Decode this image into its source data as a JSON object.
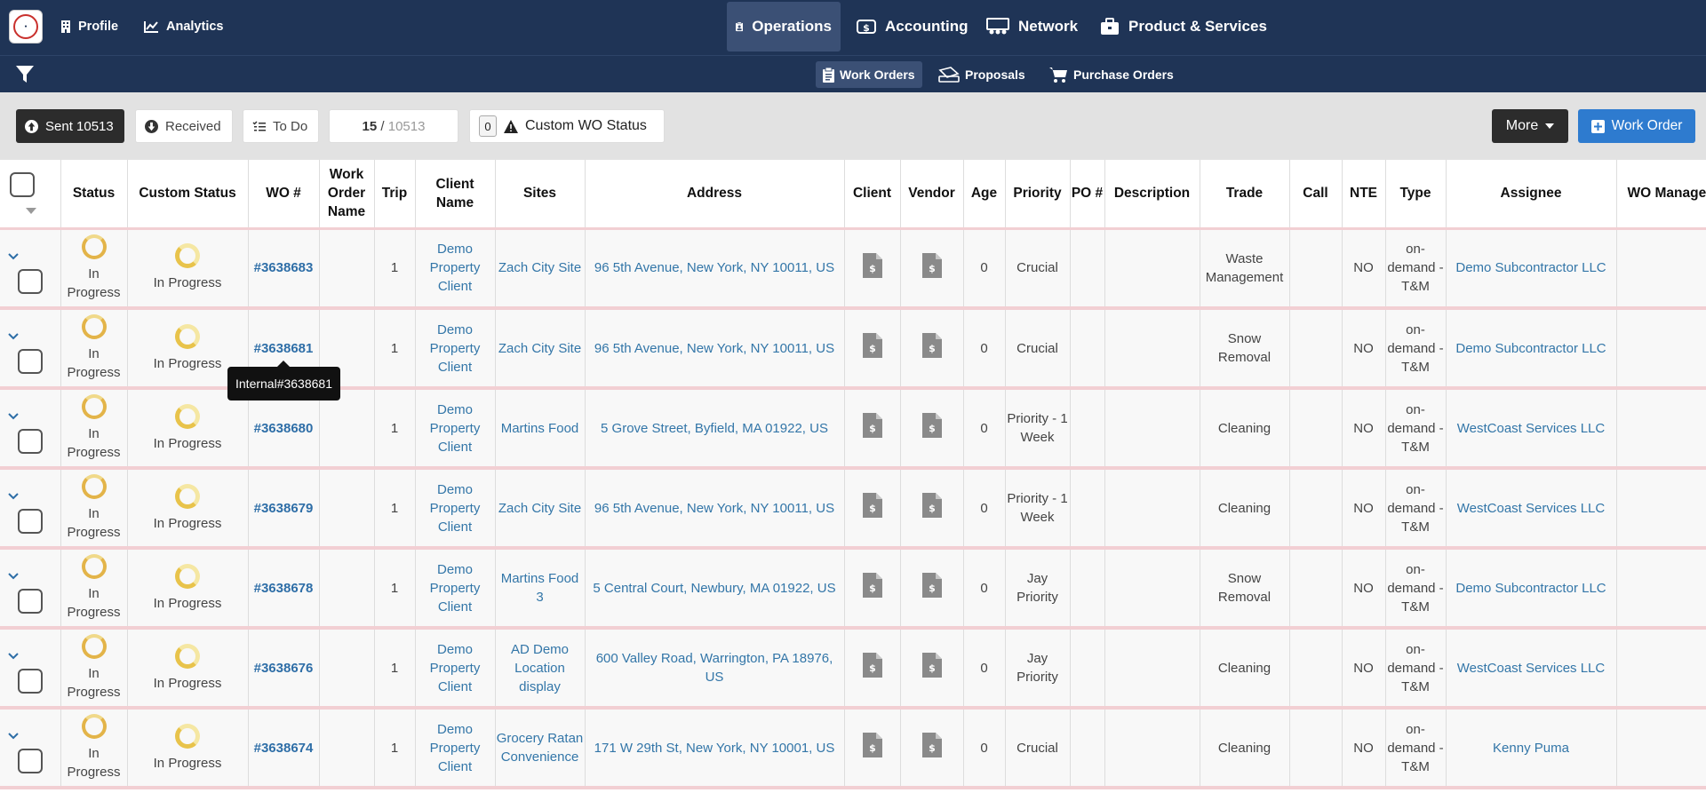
{
  "nav": {
    "profile": "Profile",
    "analytics": "Analytics",
    "operations": "Operations",
    "accounting": "Accounting",
    "network": "Network",
    "products": "Product & Services"
  },
  "subnav": {
    "work_orders": "Work Orders",
    "proposals": "Proposals",
    "purchase_orders": "Purchase Orders"
  },
  "toolbar": {
    "sent": "Sent 10513",
    "received": "Received",
    "todo": "To Do",
    "shown": "15",
    "separator": " / ",
    "total": "10513",
    "custom_count": "0",
    "custom_label": "Custom WO Status",
    "more": "More",
    "work_order": "Work Order"
  },
  "columns": [
    "Status",
    "Custom Status",
    "WO #",
    "Work Order Name",
    "Trip",
    "Client Name",
    "Sites",
    "Address",
    "Client",
    "Vendor",
    "Age",
    "Priority",
    "PO #",
    "Description",
    "Trade",
    "Call",
    "NTE",
    "Type",
    "Assignee",
    "WO Manager"
  ],
  "rows": [
    {
      "status": "In Progress",
      "custom": "In Progress",
      "wo": "#3638683",
      "name": "",
      "trip": "1",
      "client": "Demo Property Client",
      "site": "Zach City Site",
      "address": "96 5th Avenue, New York, NY 10011, US",
      "age": "0",
      "priority": "Crucial",
      "po": "",
      "desc": "",
      "trade": "Waste Management",
      "call": "",
      "nte": "NO",
      "type": "on-demand - T&M",
      "assignee": "Demo Subcontractor LLC",
      "manager": ""
    },
    {
      "status": "In Progress",
      "custom": "In Progress",
      "wo": "#3638681",
      "name": "",
      "trip": "1",
      "client": "Demo Property Client",
      "site": "Zach City Site",
      "address": "96 5th Avenue, New York, NY 10011, US",
      "age": "0",
      "priority": "Crucial",
      "po": "",
      "desc": "",
      "trade": "Snow Removal",
      "call": "",
      "nte": "NO",
      "type": "on-demand - T&M",
      "assignee": "Demo Subcontractor LLC",
      "manager": ""
    },
    {
      "status": "In Progress",
      "custom": "In Progress",
      "wo": "#3638680",
      "name": "",
      "trip": "1",
      "client": "Demo Property Client",
      "site": "Martins Food",
      "address": "5 Grove Street, Byfield, MA 01922, US",
      "age": "0",
      "priority": "Priority - 1 Week",
      "po": "",
      "desc": "",
      "trade": "Cleaning",
      "call": "",
      "nte": "NO",
      "type": "on-demand - T&M",
      "assignee": "WestCoast Services LLC",
      "manager": ""
    },
    {
      "status": "In Progress",
      "custom": "In Progress",
      "wo": "#3638679",
      "name": "",
      "trip": "1",
      "client": "Demo Property Client",
      "site": "Zach City Site",
      "address": "96 5th Avenue, New York, NY 10011, US",
      "age": "0",
      "priority": "Priority - 1 Week",
      "po": "",
      "desc": "",
      "trade": "Cleaning",
      "call": "",
      "nte": "NO",
      "type": "on-demand - T&M",
      "assignee": "WestCoast Services LLC",
      "manager": ""
    },
    {
      "status": "In Progress",
      "custom": "In Progress",
      "wo": "#3638678",
      "name": "",
      "trip": "1",
      "client": "Demo Property Client",
      "site": "Martins Food 3",
      "address": "5 Central Court, Newbury, MA 01922, US",
      "age": "0",
      "priority": "Jay Priority",
      "po": "",
      "desc": "",
      "trade": "Snow Removal",
      "call": "",
      "nte": "NO",
      "type": "on-demand - T&M",
      "assignee": "Demo Subcontractor LLC",
      "manager": ""
    },
    {
      "status": "In Progress",
      "custom": "In Progress",
      "wo": "#3638676",
      "name": "",
      "trip": "1",
      "client": "Demo Property Client",
      "site": "AD Demo Location display",
      "address": "600 Valley Road, Warrington, PA 18976, US",
      "age": "0",
      "priority": "Jay Priority",
      "po": "",
      "desc": "",
      "trade": "Cleaning",
      "call": "",
      "nte": "NO",
      "type": "on-demand - T&M",
      "assignee": "WestCoast Services LLC",
      "manager": ""
    },
    {
      "status": "In Progress",
      "custom": "In Progress",
      "wo": "#3638674",
      "name": "",
      "trip": "1",
      "client": "Demo Property Client",
      "site": "Grocery Ratan Convenience",
      "address": "171 W 29th St, New York, NY 10001, US",
      "age": "0",
      "priority": "Crucial",
      "po": "",
      "desc": "",
      "trade": "Cleaning",
      "call": "",
      "nte": "NO",
      "type": "on-demand - T&M",
      "assignee": "Kenny Puma",
      "manager": ""
    }
  ],
  "tooltip": "Internal#3638681",
  "colors": {
    "navy": "#1f3456",
    "link": "#3376a8",
    "spinner": "#e3b449",
    "row_border": "#f2cfd3",
    "primary": "#2e7bcf"
  }
}
